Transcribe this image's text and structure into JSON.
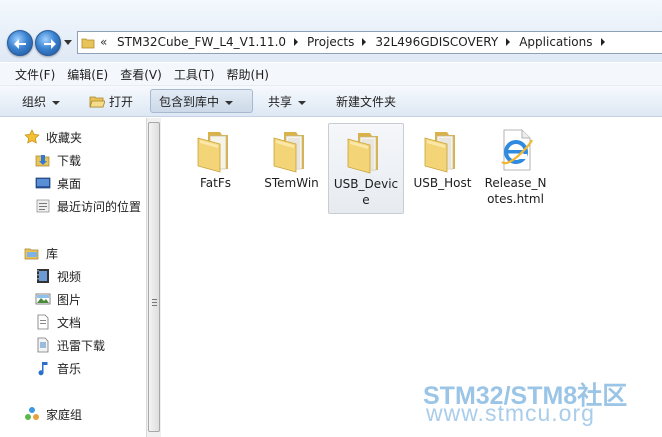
{
  "address_bar": {
    "overflow": "«",
    "crumbs": [
      "STM32Cube_FW_L4_V1.11.0",
      "Projects",
      "32L496GDISCOVERY",
      "Applications"
    ]
  },
  "menu": [
    "文件(F)",
    "编辑(E)",
    "查看(V)",
    "工具(T)",
    "帮助(H)"
  ],
  "toolbar": {
    "organize": "组织",
    "open": "打开",
    "include_in_library": "包含到库中",
    "share": "共享",
    "new_folder": "新建文件夹"
  },
  "nav": {
    "favorites": {
      "title": "收藏夹",
      "items": [
        "下载",
        "桌面",
        "最近访问的位置"
      ]
    },
    "libraries": {
      "title": "库",
      "items": [
        "视频",
        "图片",
        "文档",
        "迅雷下载",
        "音乐"
      ]
    },
    "homegroup": "家庭组"
  },
  "files": [
    {
      "label_lines": [
        "FatFs"
      ],
      "icon": "folder-icon",
      "selected": false
    },
    {
      "label_lines": [
        "STemWin"
      ],
      "icon": "folder-icon",
      "selected": false
    },
    {
      "label_lines": [
        "USB_Devic",
        "e"
      ],
      "icon": "folder-icon",
      "selected": true
    },
    {
      "label_lines": [
        "USB_Host"
      ],
      "icon": "folder-icon",
      "selected": false
    },
    {
      "label_lines": [
        "Release_N",
        "otes.html"
      ],
      "icon": "internet-explorer-icon",
      "selected": false
    }
  ],
  "watermark": {
    "line1": "STM32/STM8社区",
    "line2": "www.stmcu.org"
  },
  "colors": {
    "toolbar_bg": "#dde8f4",
    "selection_bg": "#e7ebf0",
    "watermark": "#9bc5e6"
  }
}
